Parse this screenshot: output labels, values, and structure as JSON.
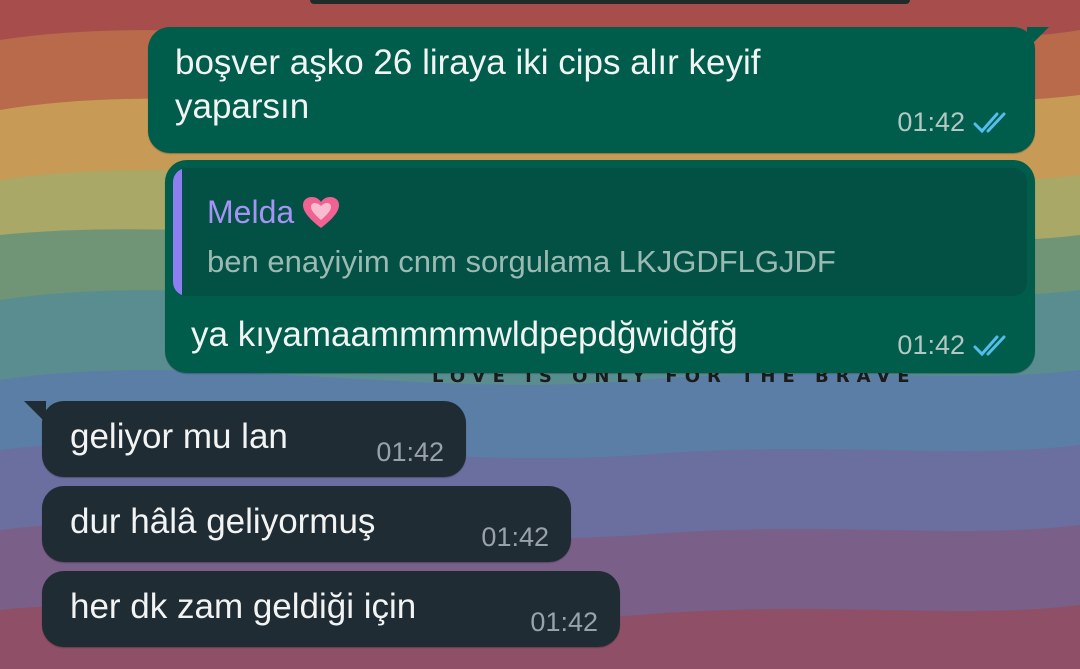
{
  "wallpaper": {
    "caption": "LOVE IS ONLY FOR THE BRAVE",
    "band_colors": [
      "#b5594c",
      "#c8884e",
      "#c9b360",
      "#7c9b6a",
      "#5d8f8a",
      "#5c7ea2",
      "#6c6c9a",
      "#7d5c84",
      "#8d4f66"
    ]
  },
  "colors": {
    "outgoing_bubble": "#005c4b",
    "incoming_bubble": "#1f2c34",
    "quote_bar": "#8d7ef2",
    "read_ticks": "#53bdeb"
  },
  "messages": [
    {
      "direction": "outgoing",
      "text": "boşver aşko 26 liraya iki cips alır keyif\nyaparsın",
      "time": "01:42",
      "status_icon": "double-check-read-icon"
    },
    {
      "direction": "outgoing",
      "reply_to": {
        "sender": "Melda",
        "sender_emoji_icon": "pink-heart-icon",
        "text": "ben enayiyim cnm sorgulama LKJGDFLGJDF"
      },
      "text": "ya kıyamaammmmwldpepdğwidğfğ",
      "time": "01:42",
      "status_icon": "double-check-read-icon"
    },
    {
      "direction": "incoming",
      "text": "geliyor mu lan",
      "time": "01:42"
    },
    {
      "direction": "incoming",
      "text": "dur hâlâ geliyormuş",
      "time": "01:42"
    },
    {
      "direction": "incoming",
      "text": "her dk zam geldiği için",
      "time": "01:42"
    }
  ]
}
